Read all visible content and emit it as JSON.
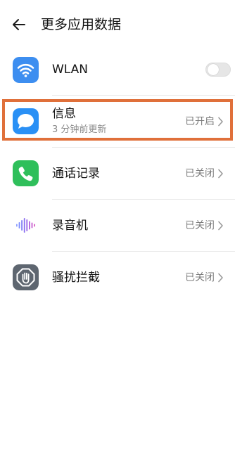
{
  "header": {
    "title": "更多应用数据",
    "back_icon": "back-arrow-icon"
  },
  "items": [
    {
      "label": "WLAN",
      "icon": "wifi-icon",
      "control": "toggle",
      "toggle_on": false
    },
    {
      "label": "信息",
      "subtitle": "3 分钟前更新",
      "icon": "message-icon",
      "status": "已开启",
      "highlighted": true,
      "highlight_color": "#e0703a"
    },
    {
      "label": "通话记录",
      "icon": "phone-icon",
      "status": "已关闭"
    },
    {
      "label": "录音机",
      "icon": "recorder-waveform-icon",
      "status": "已关闭"
    },
    {
      "label": "骚扰拦截",
      "icon": "harassment-block-icon",
      "status": "已关闭"
    }
  ],
  "colors": {
    "wifi_icon_bg": "#3d8ef0",
    "message_icon_bg": "#2a90f5",
    "phone_icon_bg": "#2fbf5b",
    "block_icon_bg": "#5e6670"
  }
}
